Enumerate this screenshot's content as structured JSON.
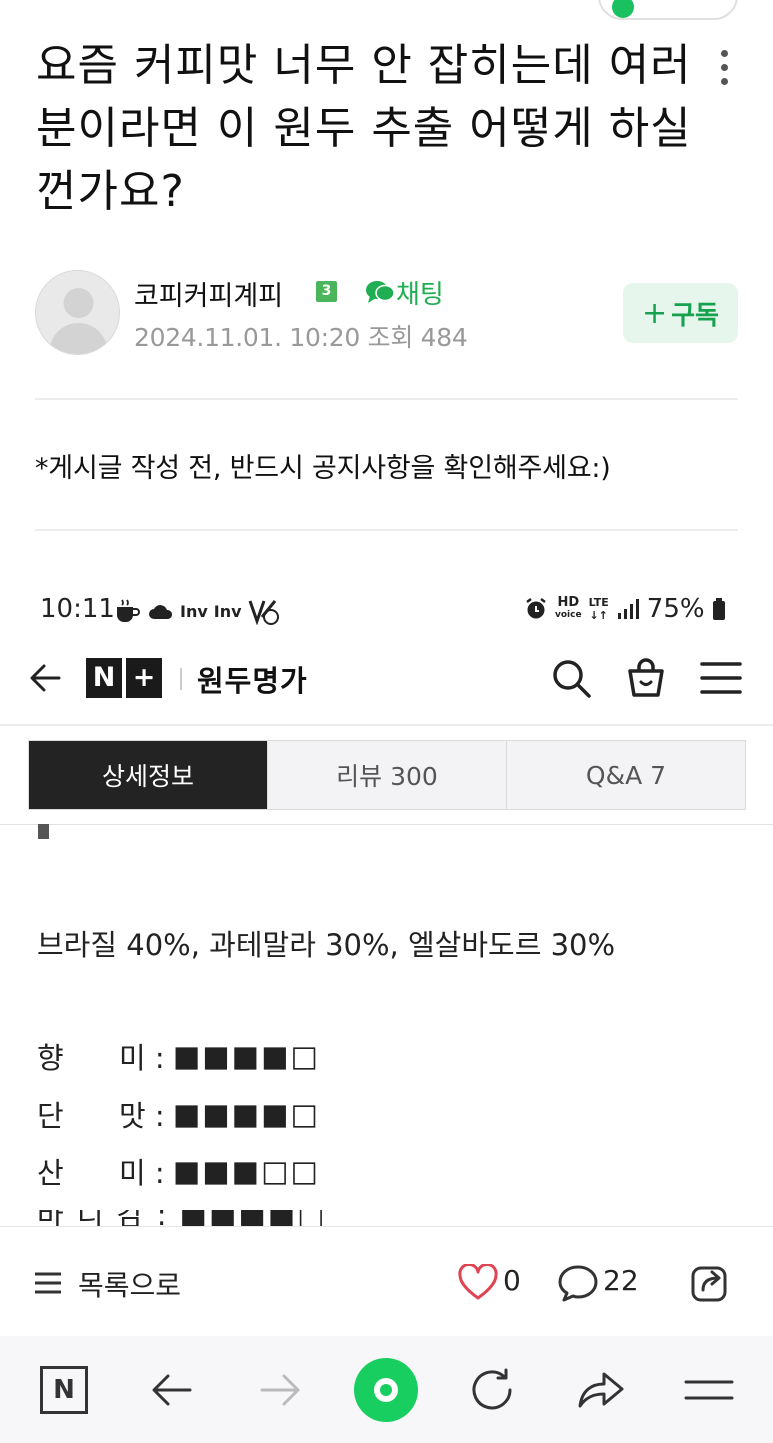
{
  "post": {
    "title": "요즘 커피맛 너무 안 잡히는데 여러분이라면 이 원두 추출 어떻게 하실껀가요?",
    "author": "코피커피계피",
    "level": "3",
    "chat_label": "채팅",
    "meta": "2024.11.01. 10:20  조회 484",
    "subscribe_label": "구독",
    "notice": "*게시글 작성 전, 반드시 공지사항을 확인해주세요:)"
  },
  "embedded": {
    "status_time": "10:11",
    "status_apps": [
      "Inv",
      "Inv"
    ],
    "battery": "75%",
    "hd_label": "HD",
    "voice_label": "voice",
    "lte_label": "LTE",
    "store_name": "원두명가",
    "tabs": [
      {
        "label": "상세정보",
        "active": true
      },
      {
        "label": "리뷰  300",
        "active": false
      },
      {
        "label": "Q&A  7",
        "active": false
      }
    ],
    "blend": "브라질 40%, 과테말라 30%, 엘살바도르 30%",
    "ratings": [
      {
        "label": "향      미 :",
        "value": "■■■■□"
      },
      {
        "label": "단      맛 :",
        "value": "■■■■□"
      },
      {
        "label": "산      미 :",
        "value": "■■■□□"
      }
    ],
    "cutoff_row": "바 디 감 : ■■■■□"
  },
  "article_bar": {
    "list_label": "목록으로",
    "like_count": "0",
    "comment_count": "22"
  },
  "browser": {
    "home_label": "N"
  },
  "colors": {
    "accent_green": "#19c160",
    "subscribe_bg": "#e7f6ec",
    "heart_red": "#e04452",
    "tab_active": "#232323"
  }
}
